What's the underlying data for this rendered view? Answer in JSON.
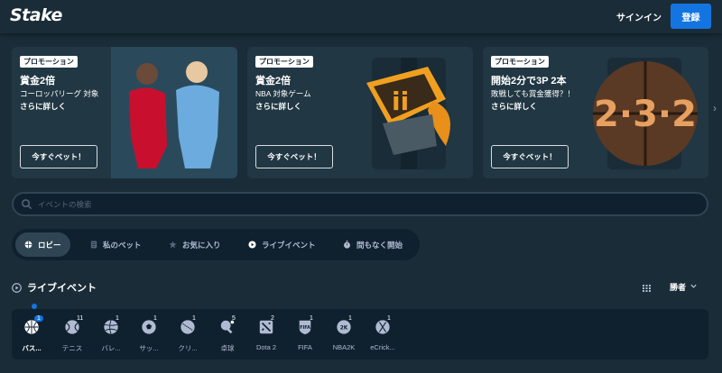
{
  "header": {
    "logo": "Stake",
    "signin": "サインイン",
    "register": "登録"
  },
  "promos": [
    {
      "tag": "プロモーション",
      "title": "賞金2倍",
      "subtitle": "コーロッパリーグ 対象",
      "more": "さらに詳しく",
      "button": "今すぐベット！"
    },
    {
      "tag": "プロモーション",
      "title": "賞金2倍",
      "subtitle": "NBA 対象ゲーム",
      "more": "さらに詳しく",
      "button": "今すぐベット！"
    },
    {
      "tag": "プロモーション",
      "title": "開始2分で3P 2本",
      "subtitle": "敗戦しても賞金獲得？！",
      "more": "さらに詳しく",
      "button": "今すぐベット！",
      "art_text": "2·3·2"
    }
  ],
  "search": {
    "placeholder": "イベントの検索"
  },
  "tabs": [
    {
      "label": "ロビー",
      "active": true
    },
    {
      "label": "私のベット"
    },
    {
      "label": "お気に入り"
    },
    {
      "label": "ライブイベント"
    },
    {
      "label": "間もなく開始"
    }
  ],
  "live": {
    "title": "ライブイベント",
    "sort_label": "勝者"
  },
  "sports": [
    {
      "label": "バス...",
      "count": "1",
      "icon": "basketball-icon",
      "active": true
    },
    {
      "label": "テニス",
      "count": "11",
      "icon": "tennis-icon"
    },
    {
      "label": "バレ...",
      "count": "1",
      "icon": "volleyball-icon"
    },
    {
      "label": "サッ...",
      "count": "1",
      "icon": "soccer-icon"
    },
    {
      "label": "クリ...",
      "count": "1",
      "icon": "cricket-icon"
    },
    {
      "label": "卓球",
      "count": "5",
      "icon": "table-tennis-icon"
    },
    {
      "label": "Dota 2",
      "count": "2",
      "icon": "dota2-icon"
    },
    {
      "label": "FIFA",
      "count": "1",
      "icon": "fifa-icon"
    },
    {
      "label": "NBA2K",
      "count": "1",
      "icon": "nba2k-icon"
    },
    {
      "label": "eCrick...",
      "count": "1",
      "icon": "ecricket-icon"
    }
  ],
  "colors": {
    "bg": "#1a2c38",
    "card": "#213743",
    "dark": "#0f212e",
    "accent": "#1475e1",
    "muted": "#b1bad3"
  }
}
